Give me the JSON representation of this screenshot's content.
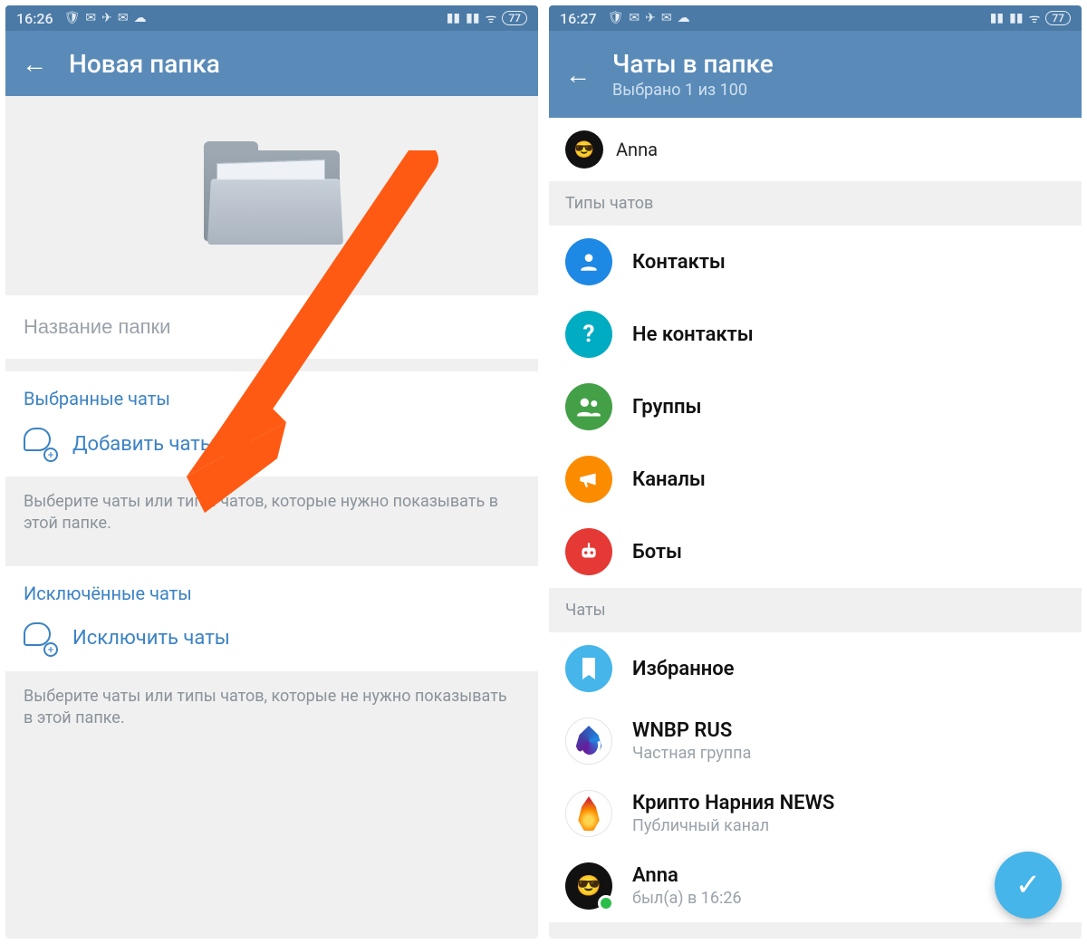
{
  "left": {
    "status": {
      "time": "16:26",
      "battery": "77"
    },
    "header": {
      "title": "Новая папка"
    },
    "input": {
      "placeholder": "Название папки"
    },
    "included": {
      "title": "Выбранные чаты",
      "action": "Добавить чаты",
      "footer": "Выберите чаты или типы чатов, которые нужно показывать в этой папке."
    },
    "excluded": {
      "title": "Исключённые чаты",
      "action": "Исключить чаты",
      "footer": "Выберите чаты или типы чатов, которые не нужно показывать в этой папке."
    }
  },
  "right": {
    "status": {
      "time": "16:27",
      "battery": "77"
    },
    "header": {
      "title": "Чаты в папке",
      "subtitle": "Выбрано 1 из 100"
    },
    "selected_chip": {
      "name": "Anna"
    },
    "group_types_title": "Типы чатов",
    "types": [
      {
        "label": "Контакты",
        "icon": "person",
        "color": "blue"
      },
      {
        "label": "Не контакты",
        "icon": "question",
        "color": "cyan"
      },
      {
        "label": "Группы",
        "icon": "group",
        "color": "green"
      },
      {
        "label": "Каналы",
        "icon": "megaphone",
        "color": "orange"
      },
      {
        "label": "Боты",
        "icon": "bot",
        "color": "red"
      }
    ],
    "group_chats_title": "Чаты",
    "chats": [
      {
        "title": "Избранное",
        "subtitle": "",
        "avatar": "bookmark",
        "color": "sky"
      },
      {
        "title": "WNBP RUS",
        "subtitle": "Частная группа",
        "avatar": "wnbp",
        "color": "white"
      },
      {
        "title": "Крипто Нарния NEWS",
        "subtitle": "Публичный канал",
        "avatar": "flame",
        "color": "white"
      },
      {
        "title": "Anna",
        "subtitle": "был(а) в 16:26",
        "avatar": "anna",
        "color": "dark",
        "online": true
      }
    ],
    "fab_icon": "check"
  },
  "colors": {
    "accent": "#3b82c4",
    "header": "#5a8bb8",
    "arrow": "#ff5a13"
  }
}
